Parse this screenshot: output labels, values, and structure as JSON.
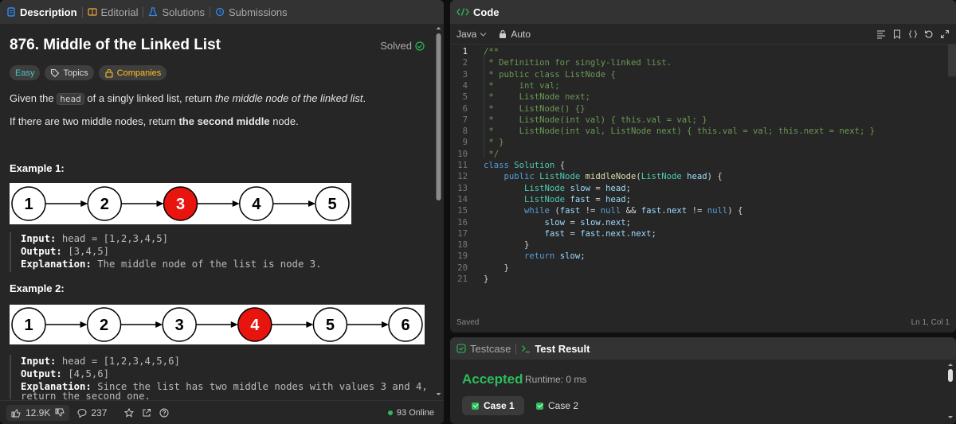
{
  "left_tabs": [
    {
      "label": "Description",
      "active": true,
      "icon": "description-icon"
    },
    {
      "label": "Editorial",
      "active": false,
      "icon": "book-icon"
    },
    {
      "label": "Solutions",
      "active": false,
      "icon": "flask-icon"
    },
    {
      "label": "Submissions",
      "active": false,
      "icon": "history-icon"
    }
  ],
  "problem": {
    "title": "876. Middle of the Linked List",
    "status": "Solved",
    "difficulty": "Easy",
    "topics_label": "Topics",
    "companies_label": "Companies",
    "desc_pre": "Given the ",
    "desc_code": "head",
    "desc_mid": " of a singly linked list, return ",
    "desc_em": "the middle node of the linked list",
    "desc_end": ".",
    "desc2_pre": "If there are two middle nodes, return ",
    "desc2_bold": "the second middle",
    "desc2_end": " node."
  },
  "examples": [
    {
      "title": "Example 1:",
      "nodes": [
        "1",
        "2",
        "3",
        "4",
        "5"
      ],
      "highlight": 2,
      "input_label": "Input:",
      "input": "head = [1,2,3,4,5]",
      "output_label": "Output:",
      "output": "[3,4,5]",
      "expl_label": "Explanation:",
      "expl": "The middle node of the list is node 3."
    },
    {
      "title": "Example 2:",
      "nodes": [
        "1",
        "2",
        "3",
        "4",
        "5",
        "6"
      ],
      "highlight": 3,
      "input_label": "Input:",
      "input": "head = [1,2,3,4,5,6]",
      "output_label": "Output:",
      "output": "[4,5,6]",
      "expl_label": "Explanation:",
      "expl": "Since the list has two middle nodes with values 3 and 4, we",
      "expl2": "return the second one."
    }
  ],
  "footer": {
    "likes": "12.9K",
    "comments": "237",
    "online": "93 Online"
  },
  "code_panel": {
    "title": "Code",
    "language": "Java",
    "mode": "Auto",
    "saved": "Saved",
    "cursor": "Ln 1, Col 1",
    "lines": [
      [
        [
          "cm",
          "/**"
        ]
      ],
      [
        [
          "cm",
          " * Definition for singly-linked list."
        ]
      ],
      [
        [
          "cm",
          " * public class ListNode {"
        ]
      ],
      [
        [
          "cm",
          " *     int val;"
        ]
      ],
      [
        [
          "cm",
          " *     ListNode next;"
        ]
      ],
      [
        [
          "cm",
          " *     ListNode() {}"
        ]
      ],
      [
        [
          "cm",
          " *     ListNode(int val) { this.val = val; }"
        ]
      ],
      [
        [
          "cm",
          " *     ListNode(int val, ListNode next) { this.val = val; this.next = next; }"
        ]
      ],
      [
        [
          "cm",
          " * }"
        ]
      ],
      [
        [
          "cm",
          " */"
        ]
      ],
      [
        [
          "kw",
          "class "
        ],
        [
          "ty",
          "Solution"
        ],
        [
          "pl",
          " {"
        ]
      ],
      [
        [
          "pl",
          "    "
        ],
        [
          "kw",
          "public "
        ],
        [
          "ty",
          "ListNode "
        ],
        [
          "fn",
          "middleNode"
        ],
        [
          "pl",
          "("
        ],
        [
          "ty",
          "ListNode "
        ],
        [
          "vr",
          "head"
        ],
        [
          "pl",
          ") {"
        ]
      ],
      [
        [
          "pl",
          "        "
        ],
        [
          "ty",
          "ListNode "
        ],
        [
          "vr",
          "slow"
        ],
        [
          "pl",
          " = "
        ],
        [
          "vr",
          "head"
        ],
        [
          "pl",
          ";"
        ]
      ],
      [
        [
          "pl",
          "        "
        ],
        [
          "ty",
          "ListNode "
        ],
        [
          "vr",
          "fast"
        ],
        [
          "pl",
          " = "
        ],
        [
          "vr",
          "head"
        ],
        [
          "pl",
          ";"
        ]
      ],
      [
        [
          "pl",
          "        "
        ],
        [
          "kw",
          "while "
        ],
        [
          "pl",
          "("
        ],
        [
          "vr",
          "fast"
        ],
        [
          "pl",
          " != "
        ],
        [
          "kw",
          "null"
        ],
        [
          "pl",
          " && "
        ],
        [
          "vr",
          "fast"
        ],
        [
          "pl",
          "."
        ],
        [
          "vr",
          "next"
        ],
        [
          "pl",
          " != "
        ],
        [
          "kw",
          "null"
        ],
        [
          "pl",
          ") {"
        ]
      ],
      [
        [
          "pl",
          "            "
        ],
        [
          "vr",
          "slow"
        ],
        [
          "pl",
          " = "
        ],
        [
          "vr",
          "slow"
        ],
        [
          "pl",
          "."
        ],
        [
          "vr",
          "next"
        ],
        [
          "pl",
          ";"
        ]
      ],
      [
        [
          "pl",
          "            "
        ],
        [
          "vr",
          "fast"
        ],
        [
          "pl",
          " = "
        ],
        [
          "vr",
          "fast"
        ],
        [
          "pl",
          "."
        ],
        [
          "vr",
          "next"
        ],
        [
          "pl",
          "."
        ],
        [
          "vr",
          "next"
        ],
        [
          "pl",
          ";"
        ]
      ],
      [
        [
          "pl",
          "        }"
        ]
      ],
      [
        [
          "pl",
          "        "
        ],
        [
          "kw",
          "return "
        ],
        [
          "vr",
          "slow"
        ],
        [
          "pl",
          ";"
        ]
      ],
      [
        [
          "pl",
          "    }"
        ]
      ],
      [
        [
          "pl",
          "}"
        ]
      ]
    ]
  },
  "result_panel": {
    "tabs": [
      {
        "label": "Testcase",
        "active": false
      },
      {
        "label": "Test Result",
        "active": true
      }
    ],
    "status": "Accepted",
    "runtime": "Runtime: 0 ms",
    "cases": [
      {
        "label": "Case 1",
        "active": true
      },
      {
        "label": "Case 2",
        "active": false
      }
    ]
  },
  "colors": {
    "accent_green": "#2cbb5d",
    "easy": "#46c6c2",
    "companies": "#ffc01e",
    "highlight_node": "#e8150e",
    "tab_blue": "#2e8cf0"
  }
}
